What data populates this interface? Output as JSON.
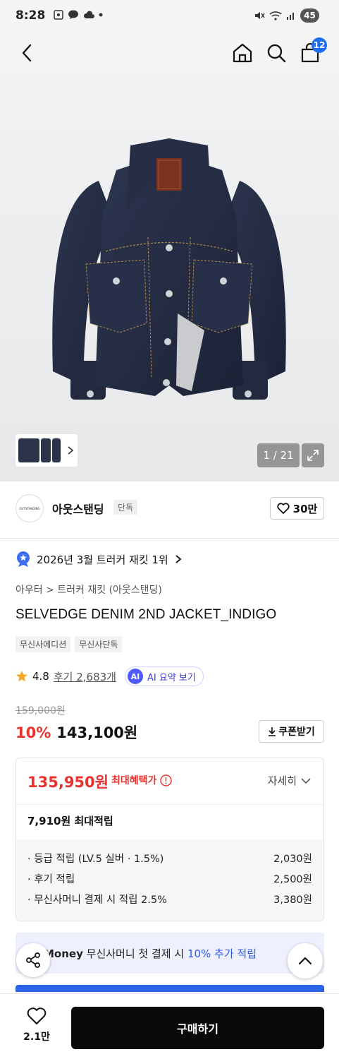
{
  "status_bar": {
    "time": "8:28",
    "battery": "45"
  },
  "header": {
    "cart_count": "12"
  },
  "gallery": {
    "counter": "1 / 21"
  },
  "brand": {
    "logo_text": "OUTSTANDING",
    "name": "아웃스탠딩",
    "tag": "단독",
    "like_count": "30만"
  },
  "ranking": {
    "text": "2026년 3월 트러커 재킷 1위"
  },
  "product": {
    "category": "아우터 > 트러커 재킷 (아웃스탠딩)",
    "title": "SELVEDGE DENIM 2ND JACKET_INDIGO",
    "tags": [
      "무신사에디션",
      "무신사단독"
    ],
    "rating": "4.8",
    "reviews": "후기 2,683개",
    "ai_summary": "AI 요약 보기",
    "ai_badge": "AI"
  },
  "price": {
    "original": "159,000원",
    "discount": "10%",
    "sale": "143,100원",
    "coupon_label": "쿠폰받기"
  },
  "benefit": {
    "max_price": "135,950원",
    "max_label": "최대혜택가",
    "detail_label": "자세히",
    "points_total": "7,910원 최대적립",
    "rows": [
      {
        "label": "· 등급 적립 (LV.5 실버 · 1.5%)",
        "value": "2,030원"
      },
      {
        "label": "· 후기 적립",
        "value": "2,500원"
      },
      {
        "label": "· 무신사머니 결제 시 적립 2.5%",
        "value": "3,380원"
      }
    ]
  },
  "money_banner": {
    "prefix": "Money",
    "text": "무신사머니 첫 결제 시",
    "highlight": "10% 추가 적립"
  },
  "bottom_bar": {
    "wish_count": "2.1만",
    "buy_label": "구매하기"
  },
  "colors": {
    "accent_red": "#e8322f",
    "accent_blue": "#2b63e8",
    "buy_button": "#0a0a0a"
  }
}
